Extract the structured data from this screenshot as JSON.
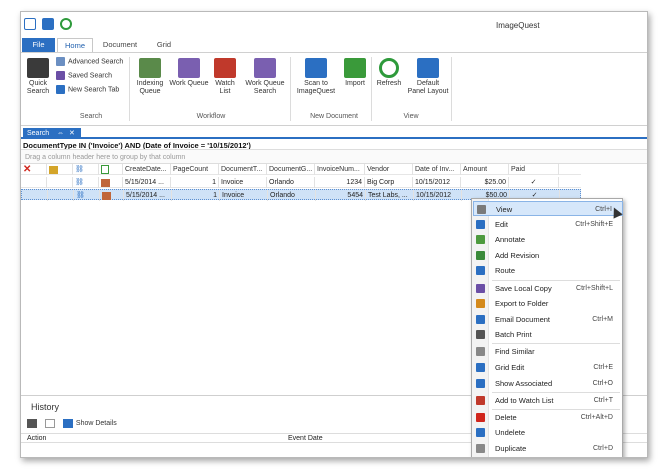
{
  "app": {
    "title": "ImageQuest"
  },
  "tabs": [
    "File",
    "Home",
    "Document",
    "Grid"
  ],
  "ribbon": {
    "search_group": {
      "label": "Search",
      "quick_search": "Quick\nSearch",
      "advanced_search": "Advanced Search",
      "saved_search": "Saved Search",
      "new_search_tab": "New Search Tab"
    },
    "workflow_group": {
      "label": "Workflow",
      "indexing_queue": "Indexing\nQueue",
      "work_queue": "Work Queue",
      "watch_list": "Watch\nList",
      "work_queue_search": "Work Queue\nSearch"
    },
    "new_document_group": {
      "label": "New Document",
      "scan": "Scan to\nImageQuest",
      "import": "Import"
    },
    "view_group": {
      "label": "View",
      "refresh": "Refresh",
      "default_panel": "Default\nPanel Layout"
    }
  },
  "doc_tab": {
    "label": "Search",
    "pin": "⇔",
    "close": "✕"
  },
  "query": "DocumentType IN ('Invoice') AND (Date of Invoice = '10/15/2012')",
  "groupby_hint": "Drag a column header here to group by that column",
  "grid": {
    "headers": [
      "CreateDate...",
      "PageCount",
      "DocumentT...",
      "DocumentG...",
      "InvoiceNum...",
      "Vendor",
      "Date of Inv...",
      "Amount",
      "Paid"
    ],
    "rows": [
      [
        "5/15/2014 ...",
        "1",
        "Invoice",
        "Orlando",
        "1234",
        "Big Corp",
        "10/15/2012",
        "$25.00",
        "✓"
      ],
      [
        "5/15/2014 ...",
        "1",
        "Invoice",
        "Orlando",
        "5454",
        "Test Labs, ...",
        "10/15/2012",
        "$50.00",
        "✓"
      ]
    ]
  },
  "history": {
    "title": "History",
    "show_details": "Show Details",
    "col_action": "Action",
    "col_event_date": "Event Date"
  },
  "context_menu": [
    {
      "label": "View",
      "shortcut": "Ctrl+I",
      "icon": "view-icon",
      "color": "#7a7a7a"
    },
    {
      "label": "Edit",
      "shortcut": "Ctrl+Shift+E",
      "icon": "edit-icon",
      "color": "#2b6fc2"
    },
    {
      "label": "Annotate",
      "shortcut": "",
      "icon": "annotate-icon",
      "color": "#4d9a3e"
    },
    {
      "label": "Add Revision",
      "shortcut": "",
      "icon": "add-revision-icon",
      "color": "#3a8a3a"
    },
    {
      "label": "Route",
      "shortcut": "",
      "icon": "route-icon",
      "color": "#2b6fc2"
    },
    {
      "label": "Save Local Copy",
      "shortcut": "Ctrl+Shift+L",
      "icon": "save-icon",
      "color": "#6b4fa6"
    },
    {
      "label": "Export to Folder",
      "shortcut": "",
      "icon": "export-icon",
      "color": "#d48a1c"
    },
    {
      "label": "Email Document",
      "shortcut": "Ctrl+M",
      "icon": "email-icon",
      "color": "#2b6fc2"
    },
    {
      "label": "Batch Print",
      "shortcut": "",
      "icon": "print-icon",
      "color": "#555555"
    },
    {
      "label": "Find Similar",
      "shortcut": "",
      "icon": "find-similar-icon",
      "color": "#888888"
    },
    {
      "label": "Grid Edit",
      "shortcut": "Ctrl+E",
      "icon": "grid-edit-icon",
      "color": "#2b6fc2"
    },
    {
      "label": "Show Associated",
      "shortcut": "Ctrl+O",
      "icon": "link-icon",
      "color": "#2b6fc2"
    },
    {
      "label": "Add to Watch List",
      "shortcut": "Ctrl+T",
      "icon": "watch-list-icon",
      "color": "#c0392b"
    },
    {
      "label": "Delete",
      "shortcut": "Ctrl+Alt+D",
      "icon": "delete-icon",
      "color": "#d0261d"
    },
    {
      "label": "Undelete",
      "shortcut": "",
      "icon": "undelete-icon",
      "color": "#2b6fc2"
    },
    {
      "label": "Duplicate",
      "shortcut": "Ctrl+D",
      "icon": "duplicate-icon",
      "color": "#888888"
    }
  ],
  "colors": {
    "accent": "#2b6fc2",
    "selection": "#cfe2f7"
  }
}
